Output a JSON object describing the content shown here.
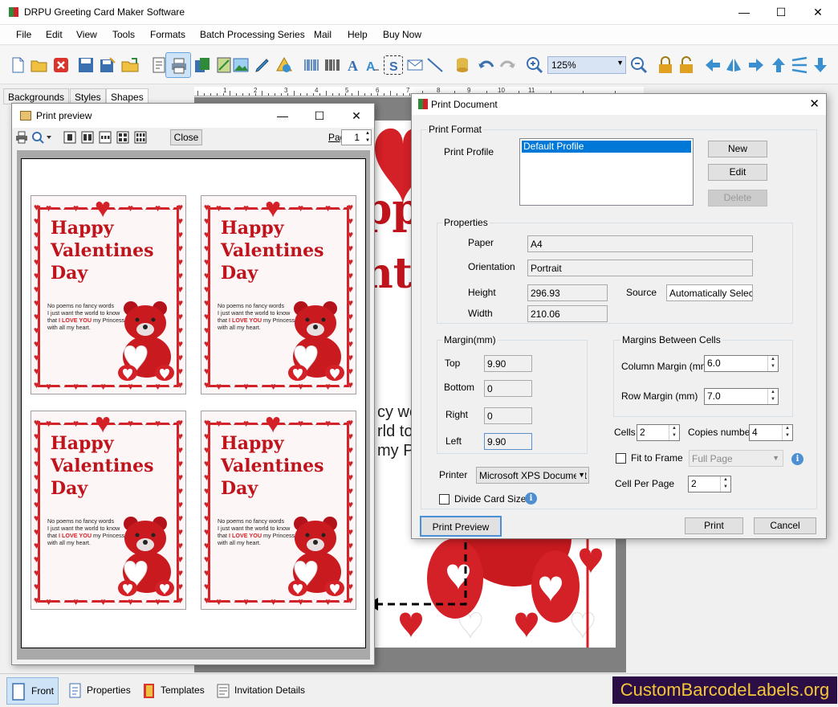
{
  "app": {
    "title": "DRPU Greeting Card Maker Software",
    "controls": {
      "minimize": "—",
      "maximize": "☐",
      "close": "✕"
    }
  },
  "menu": [
    "File",
    "Edit",
    "View",
    "Tools",
    "Formats",
    "Batch Processing Series",
    "Mail",
    "Help",
    "Buy Now"
  ],
  "toolbar": {
    "zoom": "125%",
    "icons": [
      "new-icon",
      "open-icon",
      "close-doc-icon",
      "save-icon",
      "save-as-icon",
      "export-icon",
      "properties-icon",
      "print-icon",
      "copy-icon",
      "image-icon",
      "picture-icon",
      "pencil-icon",
      "shapes-icon",
      "barcode-icon",
      "barcode2-icon",
      "text-icon",
      "wordart-icon",
      "symbol-icon",
      "mail-icon",
      "line-icon",
      "database-icon",
      "undo-icon",
      "redo-icon",
      "zoom-in-icon",
      "zoom-out-icon",
      "lock-icon",
      "unlock-icon",
      "back-icon",
      "flip-icon",
      "forward-icon",
      "up-icon",
      "align-icon",
      "down-icon"
    ]
  },
  "left_tabs": [
    "Backgrounds",
    "Styles",
    "Shapes"
  ],
  "ruler": [
    "1",
    "2",
    "3",
    "4",
    "5",
    "6",
    "7",
    "8",
    "9",
    "10",
    "11"
  ],
  "background_card": {
    "big_text": [
      "ppy",
      "nt"
    ],
    "poem": [
      "cy wo",
      "rld to",
      "my P"
    ]
  },
  "print_preview": {
    "title": "Print preview",
    "close_label": "Close",
    "page_label": "Page",
    "page_value": "1",
    "card": {
      "lines": [
        "Happy",
        "Valentines",
        "Day"
      ],
      "poem": [
        "No poems no fancy words",
        "I just want the world to know",
        "that",
        "I LOVE YOU",
        "my Princess",
        "with all my heart."
      ]
    }
  },
  "print_document": {
    "title": "Print Document",
    "print_format_label": "Print Format",
    "print_profile_label": "Print Profile",
    "profile_selected": "Default Profile",
    "buttons": {
      "new": "New",
      "edit": "Edit",
      "delete": "Delete",
      "print_preview": "Print Preview",
      "print": "Print",
      "cancel": "Cancel"
    },
    "properties": {
      "label": "Properties",
      "paper_label": "Paper",
      "paper": "A4",
      "orientation_label": "Orientation",
      "orientation": "Portrait",
      "height_label": "Height",
      "height": "296.93",
      "width_label": "Width",
      "width": "210.06",
      "source_label": "Source",
      "source": "Automatically Select"
    },
    "margin": {
      "label": "Margin(mm)",
      "top_label": "Top",
      "top": "9.90",
      "bottom_label": "Bottom",
      "bottom": "0",
      "right_label": "Right",
      "right": "0",
      "left_label": "Left",
      "left": "9.90"
    },
    "cell_margins": {
      "label": "Margins Between Cells",
      "column_label": "Column Margin (mm)",
      "column": "6.0",
      "row_label": "Row Margin (mm)",
      "row": "7.0"
    },
    "cells_label": "Cells",
    "cells": "2",
    "copies_label": "Copies number",
    "copies": "4",
    "fit_to_frame_label": "Fit to Frame",
    "fit_to_frame_value": "Full Page",
    "cell_per_page_label": "Cell Per Page",
    "cell_per_page": "2",
    "printer_label": "Printer",
    "printer": "Microsoft XPS Document",
    "divide_card_label": "Divide Card Size"
  },
  "statusbar": [
    {
      "label": "Front",
      "icon": "front-icon"
    },
    {
      "label": "Properties",
      "icon": "properties-icon"
    },
    {
      "label": "Templates",
      "icon": "templates-icon"
    },
    {
      "label": "Invitation Details",
      "icon": "invitation-icon"
    }
  ],
  "watermark": "CustomBarcodeLabels.org",
  "colors": {
    "accent": "#d42027",
    "selection": "#0078d7",
    "watermark_bg": "#2b0e46",
    "watermark_fg": "#f5c63a"
  }
}
